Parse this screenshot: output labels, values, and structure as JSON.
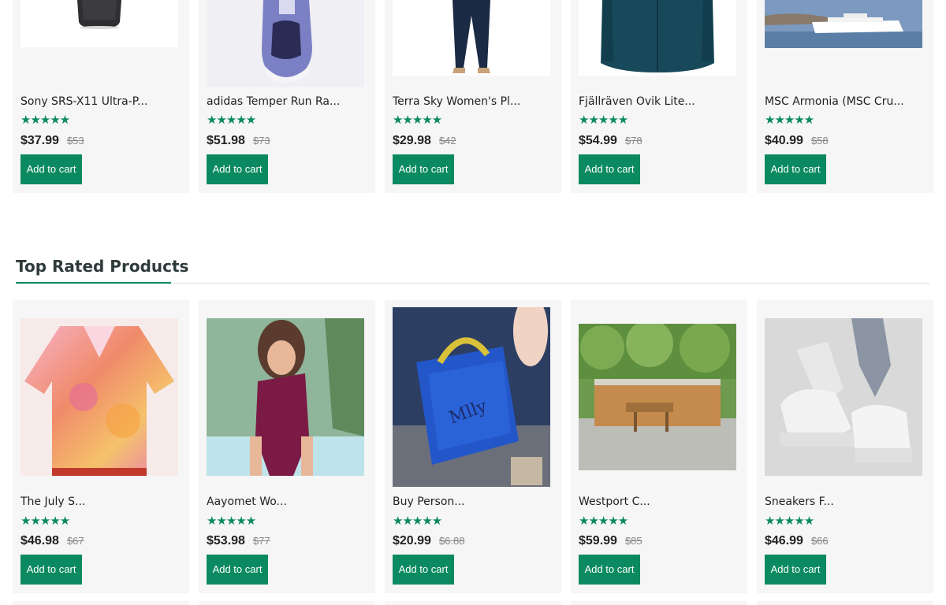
{
  "button_label": "Add to cart",
  "section": {
    "title": "Top Rated Products"
  },
  "products_top": [
    {
      "name": "Sony SRS-X11 Ultra-P...",
      "price": "$37.99",
      "old_price": "$53",
      "rating": "★★★★★"
    },
    {
      "name": "adidas Temper Run Ra...",
      "price": "$51.98",
      "old_price": "$73",
      "rating": "★★★★★"
    },
    {
      "name": "Terra Sky Women's Pl...",
      "price": "$29.98",
      "old_price": "$42",
      "rating": "★★★★★"
    },
    {
      "name": "Fjällräven Övik Lite...",
      "price": "$54.99",
      "old_price": "$78",
      "rating": "★★★★★"
    },
    {
      "name": "MSC Armonia (MSC Cru...",
      "price": "$40.99",
      "old_price": "$58",
      "rating": "★★★★★"
    }
  ],
  "products_rated": [
    {
      "name": "The July S...",
      "price": "$46.98",
      "old_price": "$67",
      "rating": "★★★★★"
    },
    {
      "name": "Aayomet Wo...",
      "price": "$53.98",
      "old_price": "$77",
      "rating": "★★★★★"
    },
    {
      "name": "Buy Person...",
      "price": "$20.99",
      "old_price": "$6.88",
      "rating": "★★★★★"
    },
    {
      "name": "Westport C...",
      "price": "$59.99",
      "old_price": "$85",
      "rating": "★★★★★"
    },
    {
      "name": "Sneakers F...",
      "price": "$46.99",
      "old_price": "$66",
      "rating": "★★★★★"
    }
  ],
  "colors": {
    "accent": "#0b8a61",
    "card_bg": "#f6f6f6",
    "title": "#2e3b3a"
  }
}
